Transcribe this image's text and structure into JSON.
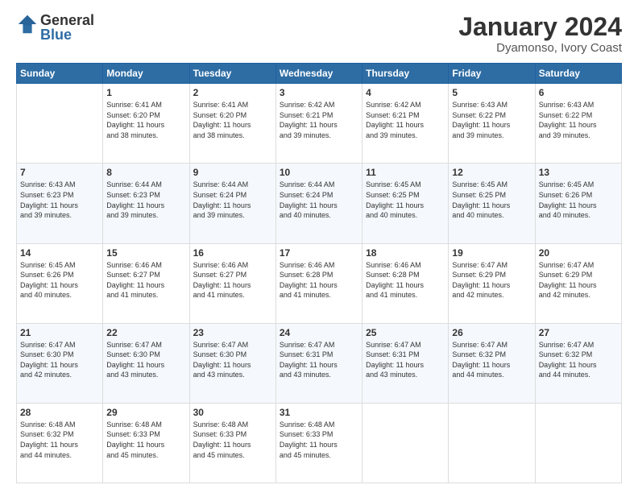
{
  "logo": {
    "general": "General",
    "blue": "Blue"
  },
  "title": "January 2024",
  "subtitle": "Dyamonso, Ivory Coast",
  "days_header": [
    "Sunday",
    "Monday",
    "Tuesday",
    "Wednesday",
    "Thursday",
    "Friday",
    "Saturday"
  ],
  "weeks": [
    [
      {
        "day": "",
        "info": ""
      },
      {
        "day": "1",
        "info": "Sunrise: 6:41 AM\nSunset: 6:20 PM\nDaylight: 11 hours\nand 38 minutes."
      },
      {
        "day": "2",
        "info": "Sunrise: 6:41 AM\nSunset: 6:20 PM\nDaylight: 11 hours\nand 38 minutes."
      },
      {
        "day": "3",
        "info": "Sunrise: 6:42 AM\nSunset: 6:21 PM\nDaylight: 11 hours\nand 39 minutes."
      },
      {
        "day": "4",
        "info": "Sunrise: 6:42 AM\nSunset: 6:21 PM\nDaylight: 11 hours\nand 39 minutes."
      },
      {
        "day": "5",
        "info": "Sunrise: 6:43 AM\nSunset: 6:22 PM\nDaylight: 11 hours\nand 39 minutes."
      },
      {
        "day": "6",
        "info": "Sunrise: 6:43 AM\nSunset: 6:22 PM\nDaylight: 11 hours\nand 39 minutes."
      }
    ],
    [
      {
        "day": "7",
        "info": "Sunrise: 6:43 AM\nSunset: 6:23 PM\nDaylight: 11 hours\nand 39 minutes."
      },
      {
        "day": "8",
        "info": "Sunrise: 6:44 AM\nSunset: 6:23 PM\nDaylight: 11 hours\nand 39 minutes."
      },
      {
        "day": "9",
        "info": "Sunrise: 6:44 AM\nSunset: 6:24 PM\nDaylight: 11 hours\nand 39 minutes."
      },
      {
        "day": "10",
        "info": "Sunrise: 6:44 AM\nSunset: 6:24 PM\nDaylight: 11 hours\nand 40 minutes."
      },
      {
        "day": "11",
        "info": "Sunrise: 6:45 AM\nSunset: 6:25 PM\nDaylight: 11 hours\nand 40 minutes."
      },
      {
        "day": "12",
        "info": "Sunrise: 6:45 AM\nSunset: 6:25 PM\nDaylight: 11 hours\nand 40 minutes."
      },
      {
        "day": "13",
        "info": "Sunrise: 6:45 AM\nSunset: 6:26 PM\nDaylight: 11 hours\nand 40 minutes."
      }
    ],
    [
      {
        "day": "14",
        "info": "Sunrise: 6:45 AM\nSunset: 6:26 PM\nDaylight: 11 hours\nand 40 minutes."
      },
      {
        "day": "15",
        "info": "Sunrise: 6:46 AM\nSunset: 6:27 PM\nDaylight: 11 hours\nand 41 minutes."
      },
      {
        "day": "16",
        "info": "Sunrise: 6:46 AM\nSunset: 6:27 PM\nDaylight: 11 hours\nand 41 minutes."
      },
      {
        "day": "17",
        "info": "Sunrise: 6:46 AM\nSunset: 6:28 PM\nDaylight: 11 hours\nand 41 minutes."
      },
      {
        "day": "18",
        "info": "Sunrise: 6:46 AM\nSunset: 6:28 PM\nDaylight: 11 hours\nand 41 minutes."
      },
      {
        "day": "19",
        "info": "Sunrise: 6:47 AM\nSunset: 6:29 PM\nDaylight: 11 hours\nand 42 minutes."
      },
      {
        "day": "20",
        "info": "Sunrise: 6:47 AM\nSunset: 6:29 PM\nDaylight: 11 hours\nand 42 minutes."
      }
    ],
    [
      {
        "day": "21",
        "info": "Sunrise: 6:47 AM\nSunset: 6:30 PM\nDaylight: 11 hours\nand 42 minutes."
      },
      {
        "day": "22",
        "info": "Sunrise: 6:47 AM\nSunset: 6:30 PM\nDaylight: 11 hours\nand 43 minutes."
      },
      {
        "day": "23",
        "info": "Sunrise: 6:47 AM\nSunset: 6:30 PM\nDaylight: 11 hours\nand 43 minutes."
      },
      {
        "day": "24",
        "info": "Sunrise: 6:47 AM\nSunset: 6:31 PM\nDaylight: 11 hours\nand 43 minutes."
      },
      {
        "day": "25",
        "info": "Sunrise: 6:47 AM\nSunset: 6:31 PM\nDaylight: 11 hours\nand 43 minutes."
      },
      {
        "day": "26",
        "info": "Sunrise: 6:47 AM\nSunset: 6:32 PM\nDaylight: 11 hours\nand 44 minutes."
      },
      {
        "day": "27",
        "info": "Sunrise: 6:47 AM\nSunset: 6:32 PM\nDaylight: 11 hours\nand 44 minutes."
      }
    ],
    [
      {
        "day": "28",
        "info": "Sunrise: 6:48 AM\nSunset: 6:32 PM\nDaylight: 11 hours\nand 44 minutes."
      },
      {
        "day": "29",
        "info": "Sunrise: 6:48 AM\nSunset: 6:33 PM\nDaylight: 11 hours\nand 45 minutes."
      },
      {
        "day": "30",
        "info": "Sunrise: 6:48 AM\nSunset: 6:33 PM\nDaylight: 11 hours\nand 45 minutes."
      },
      {
        "day": "31",
        "info": "Sunrise: 6:48 AM\nSunset: 6:33 PM\nDaylight: 11 hours\nand 45 minutes."
      },
      {
        "day": "",
        "info": ""
      },
      {
        "day": "",
        "info": ""
      },
      {
        "day": "",
        "info": ""
      }
    ]
  ]
}
